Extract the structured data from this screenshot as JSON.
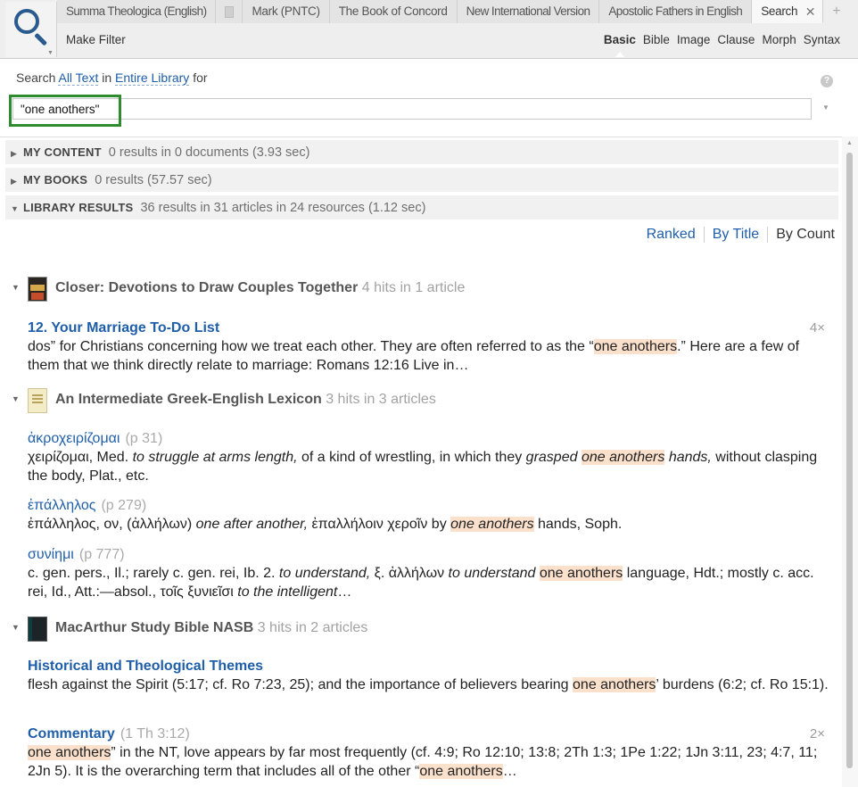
{
  "tabs": [
    {
      "label": "Summa Theologica (English)"
    },
    {
      "label": ""
    },
    {
      "label": "Mark (PNTC)"
    },
    {
      "label": "The Book of Concord"
    },
    {
      "label": "New International Version"
    },
    {
      "label": "Apostolic Fathers in English"
    },
    {
      "label": "Search"
    }
  ],
  "toolbar": {
    "make_filter": "Make Filter",
    "modes": [
      "Basic",
      "Bible",
      "Image",
      "Clause",
      "Morph",
      "Syntax"
    ]
  },
  "search": {
    "prefix": "Search",
    "scope_text": "All Text",
    "in_word": "in",
    "library_scope": "Entire Library",
    "for_word": "for",
    "query": "\"one anothers\"",
    "help": "?"
  },
  "sections": {
    "my_content": {
      "name": "MY CONTENT",
      "count": "0 results in 0 documents (3.93 sec)"
    },
    "my_books": {
      "name": "MY BOOKS",
      "count": "0 results (57.57 sec)"
    },
    "library": {
      "name": "LIBRARY RESULTS",
      "count": "36 results in 31 articles in 24 resources (1.12 sec)"
    }
  },
  "sort": {
    "ranked": "Ranked",
    "by_title": "By Title",
    "by_count": "By Count"
  },
  "books": [
    {
      "title": "Closer: Devotions to Draw Couples Together",
      "hits": "4 hits in 1 article",
      "results": [
        {
          "title": "12. Your Marriage To-Do List",
          "count": "4×",
          "pre": "dos” for Christians concerning how we treat each other. They are often referred to as the “",
          "match": "one anothers",
          "post": ".” Here are a few of them that we think directly relate to marriage: Romans 12:16 Live in…"
        }
      ]
    },
    {
      "title": "An Intermediate Greek-English Lexicon",
      "hits": "3 hits in 3 articles",
      "results": [
        {
          "title": "ἀκροχειρίζομαι",
          "page": "(p 31)",
          "a": "χειρίζομαι, Med. ",
          "b": "to struggle at arms length,",
          "c": " of a kind of wrestling, in which they ",
          "d": "grasped",
          "match": "one anothers",
          "e": "hands,",
          "f": " without clasping the body, Plat., etc."
        },
        {
          "title": "ἐπάλληλος",
          "page": "(p 279)",
          "a": "ἐπάλληλος, ον, (ἀλλήλων) ",
          "b": "one after another,",
          "c": " ἐπαλλήλοιν χεροῖν by ",
          "match": "one anothers",
          "d": " hands, Soph."
        },
        {
          "title": "συνίημι",
          "page": "(p 777)",
          "a": "c. gen. pers., Il.; rarely c. gen. rei, Ib. 2. ",
          "b": "to understand,",
          "c": " ξ. ἀλλήλων ",
          "d": "to understand",
          "match": "one anothers",
          "e": " language, Hdt.; mostly c. acc. rei, Id., Att.:—absol., τοῖς ξυνιεῖσι ",
          "f": "to the intelligent",
          "g": "…"
        }
      ]
    },
    {
      "title": "MacArthur Study Bible NASB",
      "hits": "3 hits in 2 articles",
      "results": [
        {
          "title": "Historical and Theological Themes",
          "pre": "flesh against the Spirit (5:17; cf. Ro 7:23, 25); and the importance of believers bearing ",
          "match": "one anothers",
          "post": "’ burdens (6:2; cf. Ro 15:1)."
        },
        {
          "title": "Commentary",
          "page": "(1 Th 3:12)",
          "count": "2×",
          "match": "one anothers",
          "mid": "” in the NT, love appears by far most frequently (cf. 4:9; Ro 12:10; 13:8; 2Th 1:3; 1Pe 1:22; 1Jn 3:11, 23; 4:7, 11; 2Jn 5). It is the overarching term that includes all of the other “",
          "match2": "one anothers",
          "post": "…"
        }
      ]
    }
  ]
}
